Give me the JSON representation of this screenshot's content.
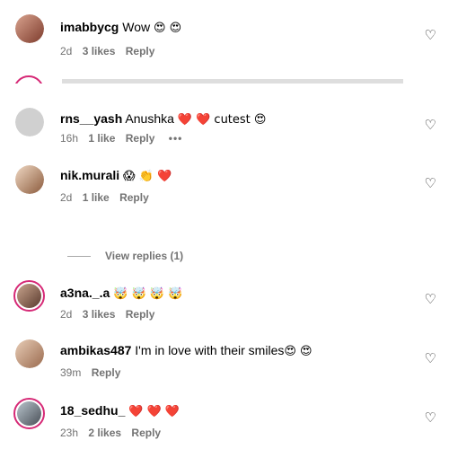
{
  "comments": [
    {
      "user": "imabbycg",
      "text": "Wow",
      "emoji": "😍 😍",
      "time": "2d",
      "likes": "3 likes",
      "reply": "Reply"
    },
    {
      "user": "rns__yash",
      "text": "Anushka",
      "emoji": "❤️ ❤️ cutest 😍",
      "time": "16h",
      "likes": "1 like",
      "reply": "Reply",
      "more": "•••"
    },
    {
      "user": "nik.murali",
      "text": "",
      "emoji": "😱 👏 ❤️",
      "time": "2d",
      "likes": "1 like",
      "reply": "Reply"
    },
    {
      "user": "a3na._.a",
      "text": "",
      "emoji": "🤯 🤯 🤯 🤯",
      "time": "2d",
      "likes": "3 likes",
      "reply": "Reply"
    },
    {
      "user": "ambikas487",
      "text": "I'm in love with their smiles",
      "emoji": "😍 😍",
      "time": "39m",
      "likes": "",
      "reply": "Reply"
    },
    {
      "user": "18_sedhu_",
      "text": "",
      "emoji": "❤️ ❤️ ❤️",
      "time": "23h",
      "likes": "2 likes",
      "reply": "Reply"
    }
  ],
  "view_replies": "View replies (1)",
  "icons": {
    "like": "heart-outline-icon",
    "more": "more-options-icon"
  },
  "colors": {
    "story_ring": "#d62976",
    "muted": "#737373"
  }
}
